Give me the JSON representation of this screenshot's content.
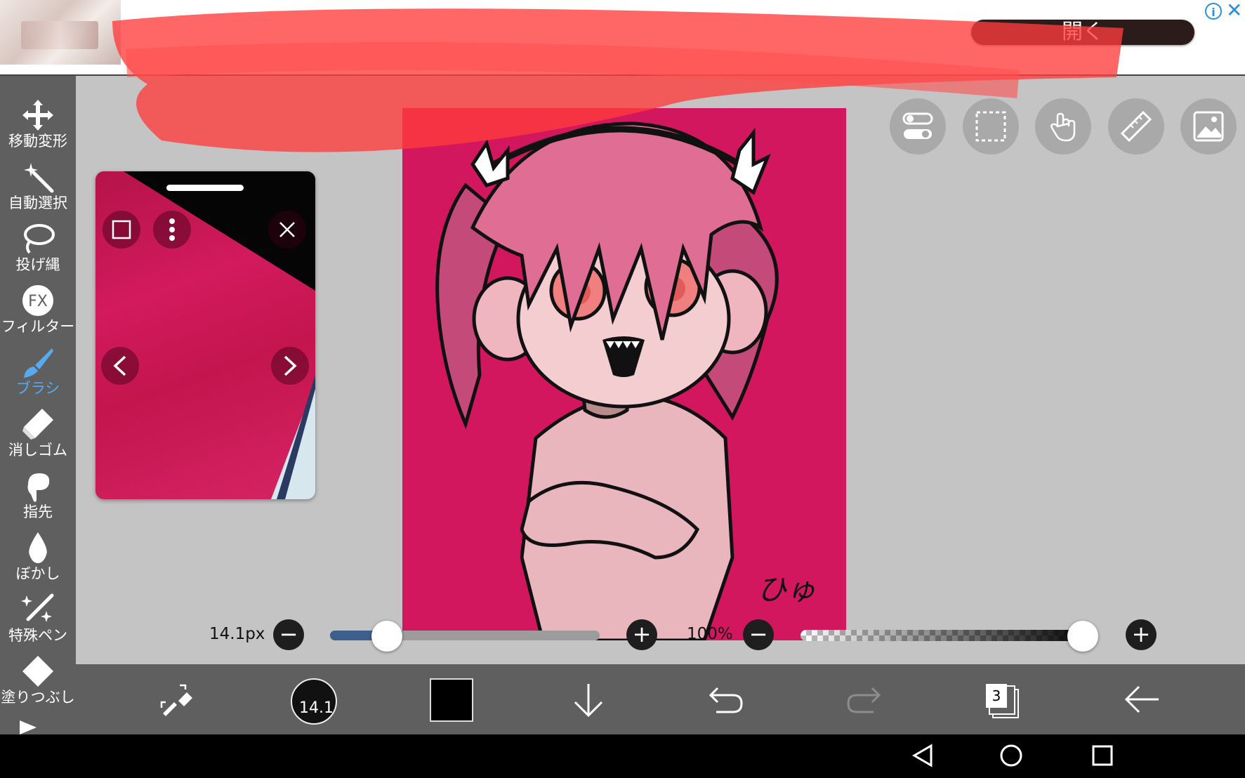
{
  "ad": {
    "open_label": "開く",
    "info_label": "i",
    "close_label": "✕"
  },
  "toolbar": {
    "items": [
      {
        "label": "移動変形",
        "icon": "move-transform-icon"
      },
      {
        "label": "自動選択",
        "icon": "magic-wand-icon"
      },
      {
        "label": "投げ縄",
        "icon": "lasso-icon"
      },
      {
        "label": "フィルター",
        "icon": "fx-filter-icon"
      },
      {
        "label": "ブラシ",
        "icon": "brush-icon",
        "active": true
      },
      {
        "label": "消しゴム",
        "icon": "eraser-icon"
      },
      {
        "label": "指先",
        "icon": "finger-smudge-icon"
      },
      {
        "label": "ぼかし",
        "icon": "blur-drop-icon"
      },
      {
        "label": "特殊ペン",
        "icon": "special-pen-icon"
      },
      {
        "label": "塗りつぶし",
        "icon": "fill-bucket-icon"
      }
    ],
    "fx_text": "FX",
    "active_color": "#55aaf0"
  },
  "reference": {
    "prev": "<",
    "next": ">",
    "close": "×"
  },
  "top_icons": [
    "toggle-icon",
    "selection-rect-icon",
    "hand-gesture-icon",
    "ruler-icon",
    "image-material-icon"
  ],
  "brush": {
    "size_label": "14.1px",
    "size_fraction": 0.2,
    "opacity_label": "100%",
    "opacity_fraction": 1.0,
    "minus": "−",
    "plus": "+"
  },
  "bottom": {
    "brush_size_short": "14.1",
    "color": "#000000",
    "layer_count": "3"
  },
  "canvas": {
    "signature": "ひゅ",
    "bg_color": "#d3175f"
  }
}
